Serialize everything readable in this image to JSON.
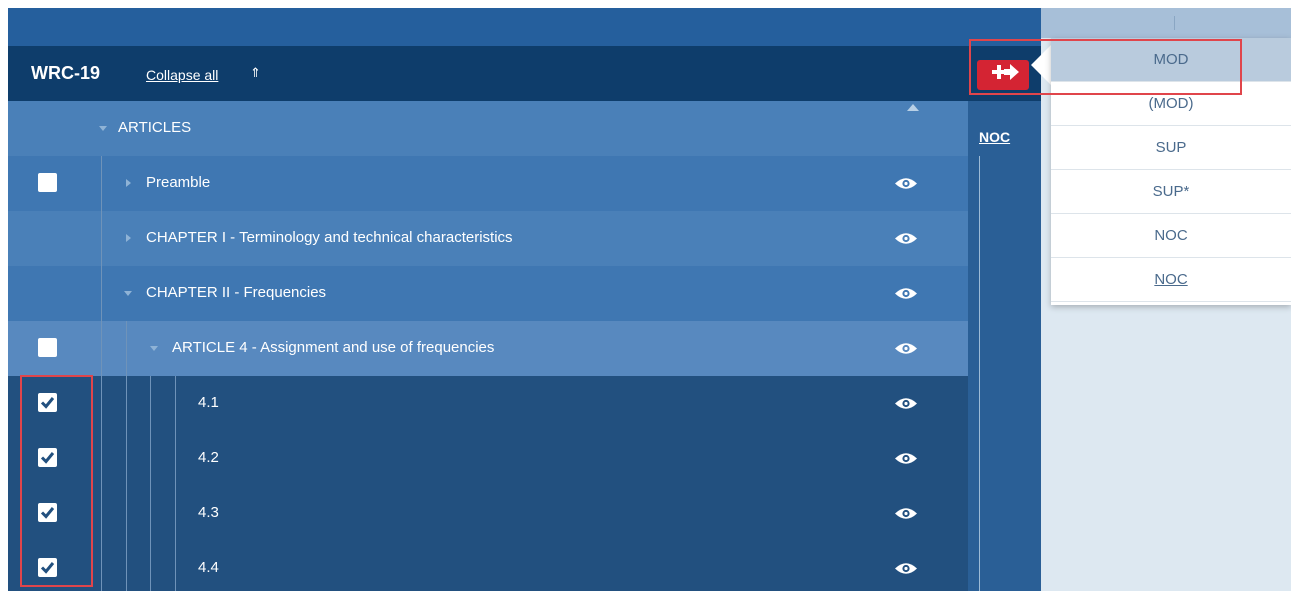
{
  "header": {
    "title": "WRC-19",
    "collapse_label": "Collapse all",
    "collapse_icon": "⇑"
  },
  "column_header": {
    "noc": "NOC"
  },
  "tree": {
    "articles": "ARTICLES",
    "preamble": "Preamble",
    "chapter1": "CHAPTER I - Terminology and technical characteristics",
    "chapter2": "CHAPTER II - Frequencies",
    "article4": "ARTICLE 4 - Assignment and use of frequencies",
    "items": [
      "4.1",
      "4.2",
      "4.3",
      "4.4"
    ]
  },
  "checkbox_state": {
    "preamble": false,
    "article4": false,
    "items": [
      true,
      true,
      true,
      true
    ]
  },
  "dropdown": {
    "options": [
      "MOD",
      "(MOD)",
      "SUP",
      "SUP*",
      "NOC",
      "NOC"
    ],
    "selected": "MOD"
  },
  "colors": {
    "header_bg": "#0e3d6b",
    "row_light": "#4a80b8",
    "row_mid": "#3f77b2",
    "row_dark": "#22507f",
    "accent_red": "#d42433",
    "highlight_border": "#e0454b"
  }
}
